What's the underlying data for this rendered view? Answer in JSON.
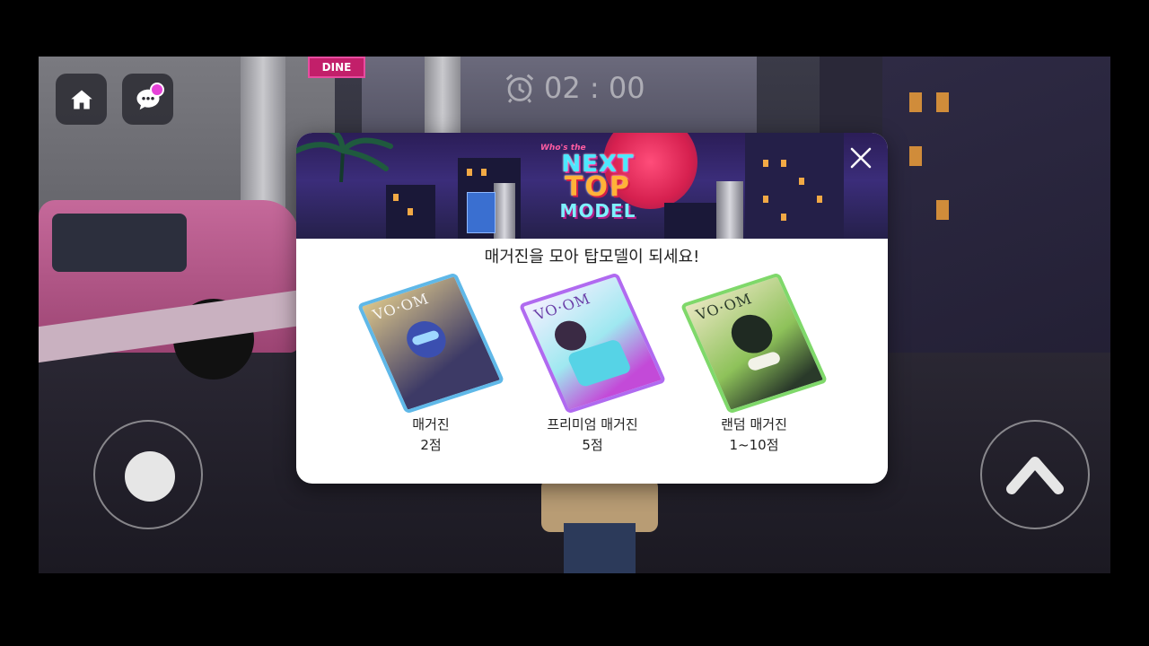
{
  "hud": {
    "timer": "02 : 00"
  },
  "modal": {
    "banner": {
      "kicker": "Who's the",
      "line1": "NEXT",
      "line2": "TOP",
      "line3": "MODEL"
    },
    "subtitle": "매거진을 모아 탑모델이 되세요!",
    "items": [
      {
        "name": "매거진",
        "points": "2점",
        "masthead": "VO·OM"
      },
      {
        "name": "프리미엄 매거진",
        "points": "5점",
        "masthead": "VO·OM"
      },
      {
        "name": "랜덤 매거진",
        "points": "1~10점",
        "masthead": "VO·OM"
      }
    ]
  },
  "scene": {
    "sign": "DINE"
  },
  "colors": {
    "notif": "#e642d8",
    "hud_bg": "#28282f",
    "mag1_frame": "#5fb8e8",
    "mag2_frame": "#b06af0",
    "mag3_frame": "#7fd86a"
  }
}
